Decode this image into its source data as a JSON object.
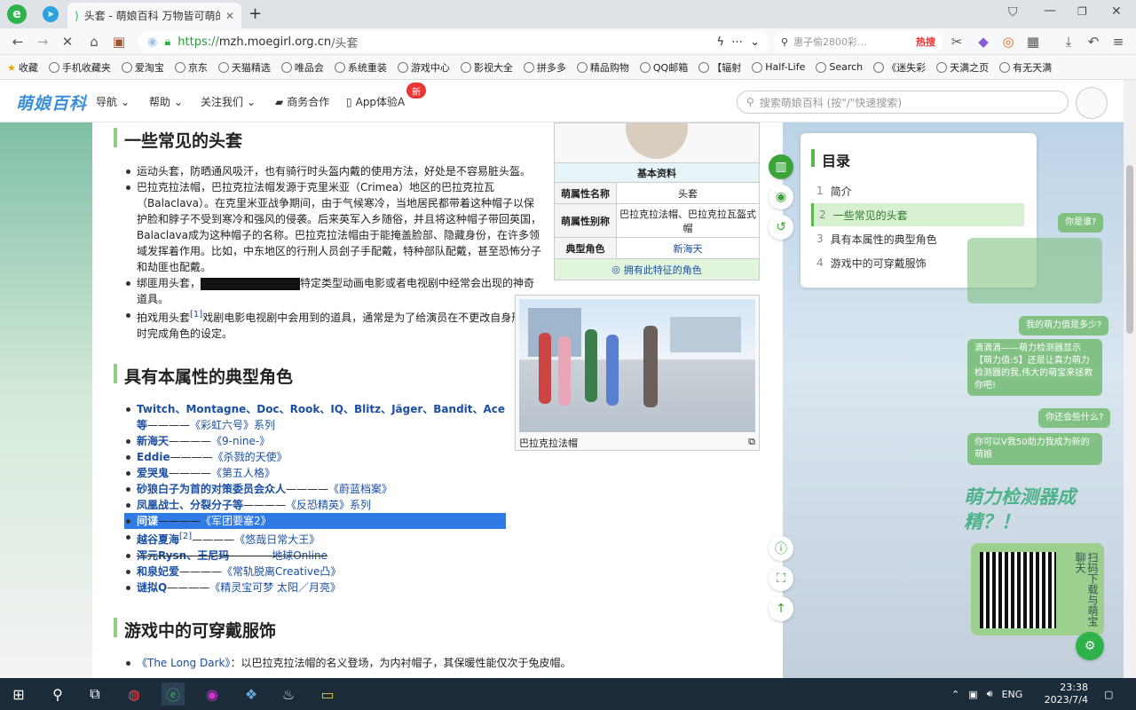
{
  "browser": {
    "tab_title": "头套 - 萌娘百科 万物皆可萌的",
    "url_scheme": "https://",
    "url_host": "mzh.moegirl.org.cn",
    "url_path": "/头套",
    "search_placeholder": "惠子偷2800彩…",
    "hot_label": "热搜",
    "bookmarks": [
      "收藏",
      "手机收藏夹",
      "爱淘宝",
      "京东",
      "天猫精选",
      "唯品会",
      "系统重装",
      "游戏中心",
      "影视大全",
      "拼多多",
      "精品购物",
      "QQ邮箱",
      "【辐射",
      "Half-Life",
      "Search",
      "《迷失彩",
      "天满之页",
      "有无天满"
    ]
  },
  "site": {
    "logo": "萌娘百科",
    "menu": [
      "导航",
      "帮助",
      "关注我们",
      "商务合作",
      "App体验A"
    ],
    "badge": "新",
    "search_placeholder": "搜索萌娘百科 (按\"/\"快速搜索)"
  },
  "article": {
    "h_common": "一些常见的头套",
    "common": [
      "运动头套，防晒通风吸汗，也有骑行时头盔内戴的使用方法，好处是不容易脏头盔。",
      "巴拉克拉法帽，巴拉克拉法帽发源于克里米亚（Crimea）地区的巴拉克拉瓦（Balaclava）。在克里米亚战争期间，由于气候寒冷，当地居民都带着这种帽子以保护脸和脖子不受到寒冷和强风的侵袭。后来英军入乡随俗，并且将这种帽子带回英国，Balaclava成为这种帽子的名称。巴拉克拉法帽由于能掩盖脸部、隐藏身份，在许多领域发挥着作用。比如，中东地区的行刑人员刽子手配戴，特种部队配戴，甚至恐怖分子和劫匪也配戴。"
    ],
    "bind_pre": "绑匪用头套，",
    "bind_post": "特定类型动画电影或者电视剧中经常会出现的神奇道具。",
    "prop_pre": "拍戏用头套",
    "prop_ref": "[1]",
    "prop_post": "戏剧电影电视剧中会用到的道具，通常是为了给演员在不更改自身形象时完成角色的设定。",
    "h_chars": "具有本属性的典型角色",
    "chars": [
      {
        "name": "Twitch、Montagne、Doc、Rook、IQ、Blitz、Jäger、Bandit、Ace等",
        "work": "《彩虹六号》系列"
      },
      {
        "name": "新海天",
        "work": "《9-nine-》"
      },
      {
        "name": "Eddie",
        "work": "《杀戮的天使》"
      },
      {
        "name": "爱哭鬼",
        "work": "《第五人格》"
      },
      {
        "name": "砂狼白子为首的对策委员会众人",
        "work": "《蔚蓝档案》"
      },
      {
        "name": "凤凰战士、分裂分子等",
        "work": "《反恐精英》系列"
      },
      {
        "name": "间谍",
        "work": "《军团要塞2》"
      },
      {
        "name": "越谷夏海",
        "ref": "[2]",
        "work": "《悠哉日常大王》"
      },
      {
        "name": "浑元Rysn、王尼玛",
        "work": "地球Online"
      },
      {
        "name": "和泉妃爱",
        "work": "《常轨脱离Creative凸》"
      },
      {
        "name": "谜拟Q",
        "work": "《精灵宝可梦 太阳／月亮》"
      }
    ],
    "dash": "————",
    "h_games": "游戏中的可穿戴服饰",
    "games": [
      {
        "work": "《The Long Dark》",
        "text": "：以巴拉克拉法帽的名义登场，为内衬帽子，其保暖性能仅次于兔皮帽。"
      }
    ],
    "image_caption": "巴拉克拉法帽"
  },
  "infobox": {
    "header": "基本资料",
    "rows": [
      {
        "k": "萌属性名称",
        "v": "头套"
      },
      {
        "k": "萌属性别称",
        "v": "巴拉克拉法帽、巴拉克拉瓦盔式帽"
      },
      {
        "k": "典型角色",
        "v": "新海天"
      }
    ],
    "footer": "拥有此特征的角色"
  },
  "toc": {
    "title": "目录",
    "items": [
      {
        "n": "1",
        "t": "简介"
      },
      {
        "n": "2",
        "t": "一些常见的头套"
      },
      {
        "n": "3",
        "t": "具有本属性的典型角色"
      },
      {
        "n": "4",
        "t": "游戏中的可穿戴服饰"
      }
    ]
  },
  "widget": {
    "q1": "你是谁?",
    "q2": "我的萌力值是多少?",
    "a2": "滴滴滴——萌力检测器显示【萌力值:5】还是让真力萌力检测器的我,伟大的萌宝来拯救你吧!",
    "q3": "你还会些什么?",
    "a3": "你可以V我50助力我成为新的萌娘",
    "banner": "萌力检测器成精？！",
    "qr_text": "扫码下载与萌宝聊天"
  },
  "taskbar": {
    "lang": "ENG",
    "time": "23:38",
    "date": "2023/7/4"
  }
}
